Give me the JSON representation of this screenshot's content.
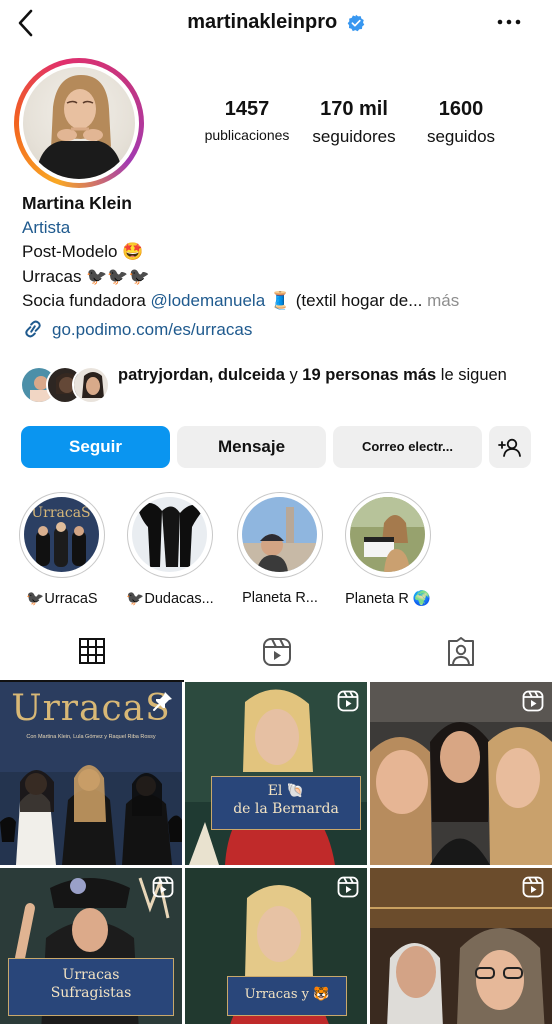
{
  "header": {
    "username": "martinakleinpro",
    "back_icon": "chevron-left-icon",
    "verified_icon": "verified-badge-icon",
    "more_icon": "more-horizontal-icon"
  },
  "stats": [
    {
      "value": "1457",
      "label": "publicaciones"
    },
    {
      "value": "170 mil",
      "label": "seguidores"
    },
    {
      "value": "1600",
      "label": "seguidos"
    }
  ],
  "bio": {
    "name": "Martina Klein",
    "category": "Artista",
    "line1": "Post-Modelo 🤩",
    "line2": "Urracas 🐦‍⬛🐦‍⬛🐦‍⬛",
    "line3_prefix": "Socia fundadora ",
    "line3_mention": "@lodemanuela",
    "line3_suffix": " 🧵 (textil hogar de...",
    "more_label": " más",
    "link": "go.podimo.com/es/urracas"
  },
  "followed_by": {
    "names": "patryjordan, dulceida",
    "connector": " y ",
    "others": "19 personas más",
    "suffix": " le siguen"
  },
  "buttons": {
    "follow": "Seguir",
    "message": "Mensaje",
    "email": "Correo electr...",
    "add_user_icon": "add-person-icon"
  },
  "highlights": [
    {
      "label": "🐦‍⬛UrracaS"
    },
    {
      "label": "🐦‍⬛Dudacas..."
    },
    {
      "label": "Planeta R..."
    },
    {
      "label": "Planeta R 🌍"
    }
  ],
  "tabs": [
    {
      "name": "grid",
      "icon": "grid-icon"
    },
    {
      "name": "reels",
      "icon": "reels-icon"
    },
    {
      "name": "tagged",
      "icon": "tagged-person-icon"
    }
  ],
  "posts": {
    "p1_title": "UrracaS",
    "p1_subtitle": "Con Martina Klein, Lula Gómez y Raquel Riba Rossy",
    "p2_caption_line1": "El 🐚",
    "p2_caption_line2": "de la Bernarda",
    "p4_caption_line1": "Urracas",
    "p4_caption_line2": "Sufragistas",
    "p5_caption": "Urracas y 🐯"
  },
  "colors": {
    "accent": "#0a95f0",
    "link": "#1f5a8e",
    "muted": "#8e8e8e"
  }
}
